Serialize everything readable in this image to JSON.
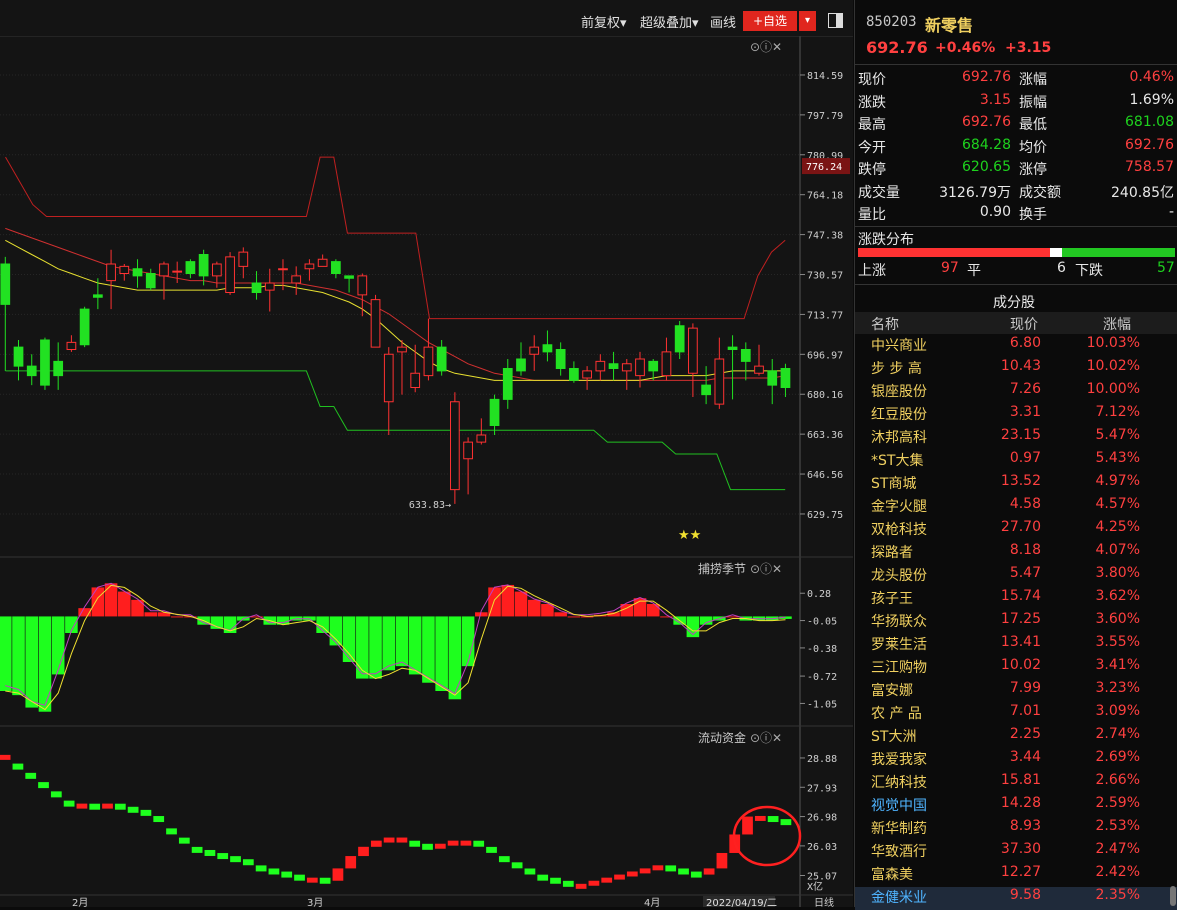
{
  "toolbar": {
    "fq": "前复权▾",
    "overlay": "超级叠加▾",
    "draw": "画线",
    "watch": "+自选",
    "watch_drop": "▾"
  },
  "panels": {
    "sub1_title": "捕捞季节",
    "sub2_title": "流动资金",
    "ctl": "⊙ⓘ✕"
  },
  "main_axis": [
    "814.59",
    "797.79",
    "780.99",
    "764.18",
    "747.38",
    "730.57",
    "713.77",
    "696.97",
    "680.16",
    "663.36",
    "646.56",
    "629.75"
  ],
  "current_price_tag": "776.24",
  "low_label": "633.83",
  "sub1_axis": [
    "0.28",
    "-0.05",
    "-0.38",
    "-0.72",
    "-1.05"
  ],
  "sub2_axis": [
    "28.88",
    "27.93",
    "26.98",
    "26.03",
    "25.07",
    "X亿"
  ],
  "x_labels": [
    "2月",
    "3月",
    "4月"
  ],
  "date_tag": "2022/04/19/二",
  "period_tag": "日线",
  "stars": "★★",
  "colors": {
    "up": "#ff3232",
    "down": "#22e122",
    "ma_yellow": "#e8e030",
    "ma_red": "#d03030",
    "bg": "#141414"
  },
  "chart_data": {
    "type": "candlestick",
    "candles": [
      [
        735,
        718,
        738,
        690
      ],
      [
        700,
        692,
        703,
        686
      ],
      [
        692,
        688,
        697,
        684
      ],
      [
        703,
        684,
        704,
        682
      ],
      [
        694,
        688,
        702,
        682
      ],
      [
        699,
        702,
        705,
        698
      ],
      [
        716,
        701,
        717,
        700
      ],
      [
        722,
        721,
        729,
        716
      ],
      [
        728,
        735,
        741,
        716
      ],
      [
        731,
        734,
        735,
        728
      ],
      [
        733,
        730,
        737,
        725
      ],
      [
        731,
        725,
        733,
        724
      ],
      [
        730,
        735,
        736,
        720
      ],
      [
        732,
        732,
        736,
        727
      ],
      [
        736,
        731,
        737,
        729
      ],
      [
        739,
        730,
        741,
        726
      ],
      [
        730,
        735,
        736,
        725
      ],
      [
        723,
        738,
        740,
        722
      ],
      [
        734,
        740,
        742,
        729
      ],
      [
        727,
        723,
        732,
        720
      ],
      [
        724,
        727,
        733,
        715
      ],
      [
        733,
        733,
        737,
        724
      ],
      [
        727,
        730,
        734,
        722
      ],
      [
        733,
        735,
        737,
        728
      ],
      [
        734,
        737,
        739,
        734
      ],
      [
        736,
        731,
        737,
        729
      ],
      [
        730,
        729,
        730,
        723
      ],
      [
        722,
        730,
        731,
        713
      ],
      [
        700,
        720,
        722,
        708
      ],
      [
        677,
        697,
        700,
        663
      ],
      [
        698,
        700,
        703,
        680
      ],
      [
        683,
        689,
        701,
        681
      ],
      [
        688,
        700,
        712,
        686
      ],
      [
        700,
        690,
        703,
        688
      ],
      [
        640,
        677,
        681,
        634
      ],
      [
        653,
        660,
        662,
        638
      ],
      [
        660,
        663,
        670,
        659
      ],
      [
        678,
        667,
        680,
        663
      ],
      [
        691,
        678,
        695,
        674
      ],
      [
        695,
        690,
        702,
        688
      ],
      [
        697,
        700,
        705,
        690
      ],
      [
        701,
        698,
        707,
        694
      ],
      [
        699,
        691,
        702,
        688
      ],
      [
        691,
        686,
        694,
        685
      ],
      [
        687,
        690,
        692,
        682
      ],
      [
        690,
        694,
        697,
        686
      ],
      [
        693,
        691,
        698,
        686
      ],
      [
        690,
        693,
        695,
        682
      ],
      [
        688,
        695,
        698,
        683
      ],
      [
        694,
        690,
        695,
        686
      ],
      [
        688,
        698,
        704,
        686
      ],
      [
        709,
        698,
        711,
        695
      ],
      [
        689,
        708,
        710,
        679
      ],
      [
        684,
        680,
        692,
        676
      ],
      [
        676,
        695,
        704,
        674
      ],
      [
        700,
        699,
        705,
        678
      ],
      [
        699,
        694,
        702,
        686
      ],
      [
        689,
        692,
        701,
        688
      ],
      [
        690,
        684,
        695,
        676
      ],
      [
        691,
        683,
        693,
        679
      ]
    ],
    "ma_yellow": [
      745,
      742,
      739,
      736,
      733,
      731,
      729,
      727,
      726,
      725,
      724,
      724,
      724,
      724,
      724,
      724,
      724,
      725,
      725,
      725,
      726,
      726,
      725,
      724,
      723,
      721,
      719,
      716,
      712,
      707,
      702,
      698,
      694,
      691,
      689,
      688,
      687,
      686,
      686,
      686,
      686,
      686,
      686,
      686,
      686,
      686,
      686,
      686,
      686,
      687,
      688,
      688,
      688,
      688,
      689,
      690,
      690,
      690,
      690,
      690
    ],
    "ma_red": [
      750,
      748,
      746,
      744,
      742,
      740,
      738,
      736,
      734,
      733,
      732,
      731,
      730,
      729,
      728,
      728,
      727,
      727,
      727,
      727,
      727,
      727,
      727,
      726,
      725,
      724,
      722,
      720,
      717,
      714,
      710,
      706,
      702,
      699,
      696,
      693,
      691,
      689,
      688,
      687,
      686,
      686,
      686,
      686,
      686,
      686,
      686,
      686,
      686,
      686,
      686,
      686,
      686,
      686,
      687,
      687,
      687,
      687,
      687,
      688
    ],
    "upper_band": [
      780,
      770,
      760,
      755,
      755,
      755,
      755,
      755,
      755,
      755,
      755,
      755,
      755,
      755,
      755,
      755,
      755,
      755,
      755,
      755,
      755,
      755,
      755,
      780,
      780,
      748,
      748,
      748,
      748,
      748,
      748,
      712,
      712,
      712,
      712,
      712,
      712,
      712,
      712,
      712,
      712,
      712,
      712,
      712,
      712,
      712,
      712,
      712,
      712,
      712,
      712,
      712,
      712,
      712,
      712,
      730,
      740,
      745
    ],
    "lower_band": [
      690,
      690,
      690,
      690,
      690,
      690,
      690,
      690,
      690,
      690,
      690,
      690,
      690,
      690,
      690,
      690,
      690,
      690,
      690,
      690,
      690,
      690,
      690,
      675,
      675,
      665,
      665,
      665,
      665,
      665,
      665,
      665,
      665,
      665,
      665,
      665,
      665,
      665,
      665,
      665,
      665,
      665,
      665,
      665,
      660,
      660,
      660,
      660,
      660,
      655,
      655,
      655,
      655,
      640,
      640,
      640,
      640,
      640
    ],
    "indicator_histogram": [
      -0.9,
      -0.95,
      -1.1,
      -1.15,
      -0.7,
      -0.2,
      0.1,
      0.35,
      0.4,
      0.3,
      0.2,
      0.05,
      0.05,
      0.0,
      0.0,
      -0.1,
      -0.15,
      -0.2,
      -0.05,
      0.0,
      -0.1,
      -0.1,
      -0.05,
      -0.05,
      -0.2,
      -0.35,
      -0.55,
      -0.75,
      -0.75,
      -0.65,
      -0.6,
      -0.7,
      -0.8,
      -0.9,
      -1.0,
      -0.6,
      0.05,
      0.35,
      0.38,
      0.3,
      0.2,
      0.15,
      0.05,
      0.0,
      0.0,
      0.02,
      0.05,
      0.15,
      0.22,
      0.15,
      0.0,
      -0.1,
      -0.25,
      -0.1,
      -0.05,
      0.0,
      -0.05,
      -0.05,
      -0.05,
      -0.03
    ],
    "flow_values": [
      28.98,
      28.6,
      28.3,
      28.0,
      27.7,
      27.4,
      27.4,
      27.3,
      27.4,
      27.3,
      27.2,
      27.1,
      26.9,
      26.5,
      26.2,
      25.9,
      25.8,
      25.7,
      25.6,
      25.5,
      25.3,
      25.2,
      25.1,
      25.0,
      25.0,
      24.9,
      25.3,
      25.7,
      26.0,
      26.2,
      26.3,
      26.3,
      26.1,
      26.0,
      26.1,
      26.2,
      26.2,
      26.1,
      25.9,
      25.6,
      25.4,
      25.2,
      25.0,
      24.9,
      24.8,
      24.8,
      24.9,
      25.0,
      25.1,
      25.2,
      25.3,
      25.4,
      25.3,
      25.2,
      25.1,
      25.3,
      25.8,
      26.4,
      26.98,
      27.0,
      26.9,
      26.8
    ],
    "ylim": [
      623,
      823
    ],
    "sub1_ylim": [
      -1.25,
      0.5
    ],
    "sub2_ylim": [
      24.6,
      29.3
    ]
  },
  "stock": {
    "code": "850203",
    "name": "新零售",
    "price": "692.76",
    "pct": "+0.46%",
    "chg": "+3.15"
  },
  "quote": [
    {
      "l": "现价",
      "lv": "692.76",
      "lc": "red",
      "r": "涨幅",
      "rv": "0.46%",
      "rc": "red"
    },
    {
      "l": "涨跌",
      "lv": "3.15",
      "lc": "red",
      "r": "振幅",
      "rv": "1.69%",
      "rc": "white"
    },
    {
      "l": "最高",
      "lv": "692.76",
      "lc": "red",
      "r": "最低",
      "rv": "681.08",
      "rc": "green"
    },
    {
      "l": "今开",
      "lv": "684.28",
      "lc": "green",
      "r": "均价",
      "rv": "692.76",
      "rc": "red"
    },
    {
      "l": "跌停",
      "lv": "620.65",
      "lc": "green",
      "r": "涨停",
      "rv": "758.57",
      "rc": "red"
    },
    {
      "l": "成交量",
      "lv": "3126.79万",
      "lc": "white",
      "r": "成交额",
      "rv": "240.85亿",
      "rc": "white"
    },
    {
      "l": "量比",
      "lv": "0.90",
      "lc": "white",
      "r": "换手",
      "rv": "-",
      "rc": "white"
    }
  ],
  "dist": {
    "title": "涨跌分布",
    "up_label": "上涨",
    "up": "97",
    "flat_label": "平",
    "flat": "6",
    "down_label": "下跌",
    "down": "57",
    "up_frac": 0.606,
    "flat_frac": 0.038
  },
  "cons": {
    "title": "成分股",
    "h_name": "名称",
    "h_price": "现价",
    "h_pct": "涨幅",
    "rows": [
      {
        "name": "中兴商业",
        "price": "6.80",
        "pct": "10.03%"
      },
      {
        "name": "步 步 高",
        "price": "10.43",
        "pct": "10.02%"
      },
      {
        "name": "银座股份",
        "price": "7.26",
        "pct": "10.00%"
      },
      {
        "name": "红豆股份",
        "price": "3.31",
        "pct": "7.12%"
      },
      {
        "name": "沐邦高科",
        "price": "23.15",
        "pct": "5.47%"
      },
      {
        "name": "*ST大集",
        "price": "0.97",
        "pct": "5.43%"
      },
      {
        "name": "ST商城",
        "price": "13.52",
        "pct": "4.97%"
      },
      {
        "name": "金字火腿",
        "price": "4.58",
        "pct": "4.57%"
      },
      {
        "name": "双枪科技",
        "price": "27.70",
        "pct": "4.25%"
      },
      {
        "name": "探路者",
        "price": "8.18",
        "pct": "4.07%"
      },
      {
        "name": "龙头股份",
        "price": "5.47",
        "pct": "3.80%"
      },
      {
        "name": "孩子王",
        "price": "15.74",
        "pct": "3.62%"
      },
      {
        "name": "华扬联众",
        "price": "17.25",
        "pct": "3.60%"
      },
      {
        "name": "罗莱生活",
        "price": "13.41",
        "pct": "3.55%"
      },
      {
        "name": "三江购物",
        "price": "10.02",
        "pct": "3.41%"
      },
      {
        "name": "富安娜",
        "price": "7.99",
        "pct": "3.23%"
      },
      {
        "name": "农 产 品",
        "price": "7.01",
        "pct": "3.09%"
      },
      {
        "name": "ST大洲",
        "price": "2.25",
        "pct": "2.74%"
      },
      {
        "name": "我爱我家",
        "price": "3.44",
        "pct": "2.69%"
      },
      {
        "name": "汇纳科技",
        "price": "15.81",
        "pct": "2.66%"
      },
      {
        "name": "视觉中国",
        "price": "14.28",
        "pct": "2.59%",
        "blue": true
      },
      {
        "name": "新华制药",
        "price": "8.93",
        "pct": "2.53%"
      },
      {
        "name": "华致酒行",
        "price": "37.30",
        "pct": "2.47%"
      },
      {
        "name": "富森美",
        "price": "12.27",
        "pct": "2.42%"
      },
      {
        "name": "金健米业",
        "price": "9.58",
        "pct": "2.35%",
        "blue": true
      }
    ]
  }
}
